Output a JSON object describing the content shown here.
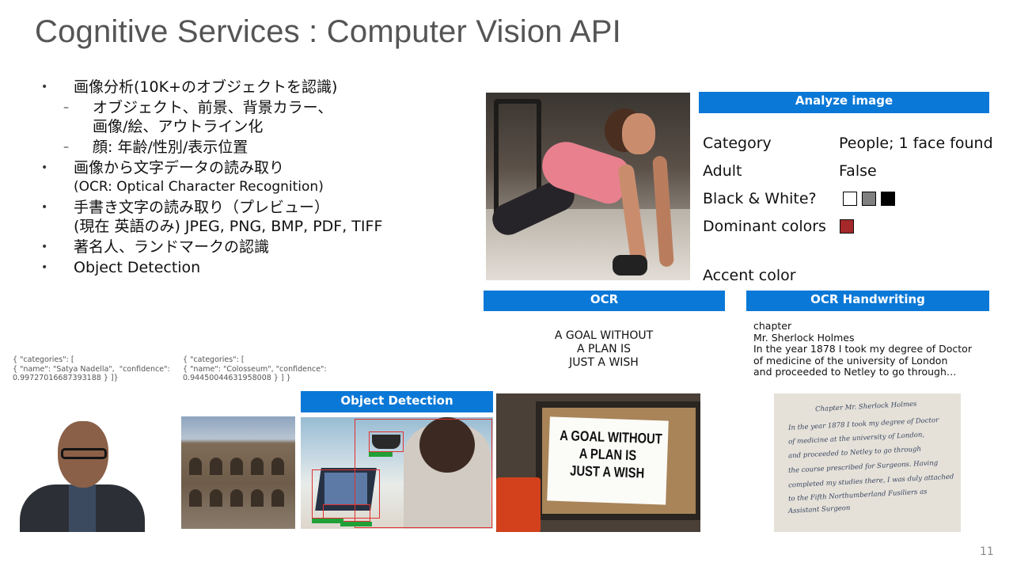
{
  "slide": {
    "title": "Cognitive Services : Computer Vision API",
    "page_number": "11"
  },
  "bullets": [
    {
      "marker": "•",
      "text": "画像分析(10K+のオブジェクトを認識)"
    },
    {
      "marker": "–",
      "text": "オブジェクト、前景、背景カラー、"
    },
    {
      "marker": "",
      "text": "画像/絵、アウトライン化"
    },
    {
      "marker": "–",
      "text": "顔: 年齢/性別/表示位置"
    },
    {
      "marker": "•",
      "text": "画像から文字データの読み取り"
    },
    {
      "marker": "",
      "text": "(OCR: Optical Character Recognition)"
    },
    {
      "marker": "•",
      "text": "手書き文字の読み取り（プレビュー）"
    },
    {
      "marker": "",
      "text": "(現在 英語のみ) JPEG, PNG, BMP, PDF, TIFF"
    },
    {
      "marker": "•",
      "text": "著名人、ランドマークの認識"
    },
    {
      "marker": "•",
      "text": "Object Detection"
    }
  ],
  "analyze": {
    "header": "Analyze image",
    "rows": [
      {
        "key": "Category",
        "value": "People; 1 face found"
      },
      {
        "key": "Adult",
        "value": "False"
      },
      {
        "key": "Black & White?",
        "value": ""
      },
      {
        "key": "Dominant colors",
        "value": ""
      },
      {
        "key": "Accent color",
        "value": ""
      }
    ],
    "bw_swatches": [
      "#ffffff",
      "#808080",
      "#000000"
    ],
    "dominant_color": "#a5282b"
  },
  "ocr": {
    "header": "OCR",
    "result": "A GOAL WITHOUT\nA PLAN IS\nJUST A WISH",
    "sign_text": "A GOAL WITHOUT\nA PLAN IS\nJUST A WISH"
  },
  "handwriting": {
    "header": "OCR Handwriting",
    "result": "chapter\nMr. Sherlock Holmes\nIn the year 1878 I took my degree of Doctor\nof medicine of the university of London\nand proceeded to Netley to go through…",
    "note_lines": [
      "Chapter      Mr. Sherlock Holmes",
      "In the year 1878 I took my degree of Doctor",
      "of medicine at the university of London,",
      "and proceeded to Netley to go through",
      "the course prescribed for Surgeons. Having",
      "completed my studies there, I was duly attached",
      "to the Fifth Northumberland Fusiliers as",
      "Assistant Surgeon"
    ]
  },
  "celebrity": {
    "json": "{ \"categories\": [\n{ \"name\": \"Satya Nadella\",  \"confidence\":\n0.99727016687393188 } ]}"
  },
  "landmark": {
    "json": "{ \"categories\": [\n{ \"name\": \"Colosseum\", \"confidence\":\n0.94450044631958008 } ] }"
  },
  "object_detection": {
    "header": "Object Detection"
  }
}
